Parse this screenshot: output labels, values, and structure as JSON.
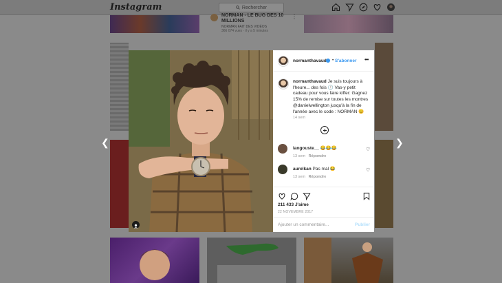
{
  "app": {
    "logo": "Instagram",
    "search_placeholder": "Rechercher"
  },
  "feed_post": {
    "title": "NORMAN - LE BUG DES 10 MILLIONS",
    "channel": "NORMAN FAIT DES VIDÉOS",
    "meta": "366 074 vues · il y a 5 minutes"
  },
  "post": {
    "username": "normanthavaud",
    "separator": "•",
    "subscribe_label": "S'abonner",
    "caption_username": "normanthavaud",
    "caption_text": " Je suis toujours à l'heure... des fois 🕐 Vas-y petit cadeau pour vous faire kiffer: Gagnez 15% de remise sur toutes les montres @danielwellington jusqu'à la fin de l'année avec le code : NORMAN 😊",
    "caption_time": "14 sem",
    "comments": [
      {
        "username": "langouste__",
        "text": " 😂😂😂",
        "time": "13 sem",
        "reply": "Répondre"
      },
      {
        "username": "aurelkan",
        "text": " Pas mal 😂",
        "time": "13 sem",
        "reply": "Répondre"
      }
    ],
    "likes": "211 433 J'aime",
    "date": "22 NOVEMBRE 2017",
    "comment_placeholder": "Ajouter un commentaire...",
    "publish_label": "Publier"
  },
  "colors": {
    "link_blue": "#3897f0",
    "text": "#262626",
    "muted": "#999999"
  }
}
